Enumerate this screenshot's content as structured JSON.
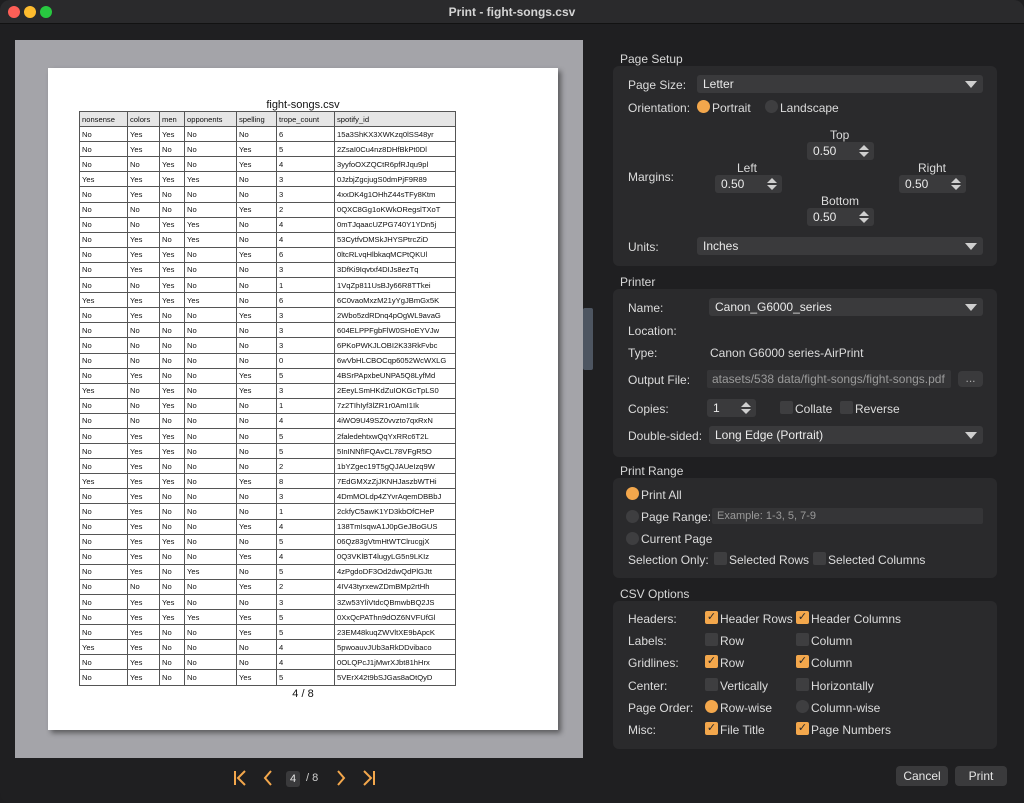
{
  "window": {
    "title": "Print - fight-songs.csv"
  },
  "preview": {
    "sheet_title": "fight-songs.csv",
    "page_indicator": "4 / 8",
    "columns": [
      "nonsense",
      "colors",
      "men",
      "opponents",
      "spelling",
      "trope_count",
      "spotify_id"
    ],
    "rows": [
      [
        "No",
        "Yes",
        "Yes",
        "No",
        "No",
        "6",
        "15a3ShKX3XWKzq0lSS48yr"
      ],
      [
        "No",
        "Yes",
        "No",
        "No",
        "Yes",
        "5",
        "2ZsaI0Cu4nz8DHfBkPt0Dl"
      ],
      [
        "No",
        "No",
        "Yes",
        "No",
        "Yes",
        "4",
        "3yyfoOXZQCtR6pfRJqu9pl"
      ],
      [
        "Yes",
        "Yes",
        "Yes",
        "Yes",
        "No",
        "3",
        "0JzbjZgcjugS0dmPjF9R89"
      ],
      [
        "No",
        "Yes",
        "No",
        "No",
        "No",
        "3",
        "4xxDK4g1OHhZ44sTFy8Ktm"
      ],
      [
        "No",
        "No",
        "No",
        "No",
        "Yes",
        "2",
        "0QXC8Gg1oKWkORegslTXoT"
      ],
      [
        "No",
        "No",
        "Yes",
        "Yes",
        "No",
        "4",
        "0mTJqaacUZPG740Y1YDn5j"
      ],
      [
        "No",
        "Yes",
        "No",
        "Yes",
        "No",
        "4",
        "53CytfvDMSkJHYSPtrcZiD"
      ],
      [
        "No",
        "Yes",
        "Yes",
        "No",
        "Yes",
        "6",
        "0ltcRLvqHlbkaqMCPtQKUl"
      ],
      [
        "No",
        "Yes",
        "Yes",
        "No",
        "No",
        "3",
        "3DfKi9Iqvtxf4DIJs8ezTq"
      ],
      [
        "No",
        "No",
        "Yes",
        "No",
        "No",
        "1",
        "1VqZp811UsBJy66R8TTkei"
      ],
      [
        "Yes",
        "Yes",
        "Yes",
        "Yes",
        "No",
        "6",
        "6C0vaoMxzM21yYgJBmGx5K"
      ],
      [
        "No",
        "Yes",
        "No",
        "No",
        "Yes",
        "3",
        "2Wbo5zdRDnq4pOgWL9avaG"
      ],
      [
        "No",
        "No",
        "No",
        "No",
        "No",
        "3",
        "604ELPPFgbFlW0SHoEYVJw"
      ],
      [
        "No",
        "No",
        "No",
        "No",
        "No",
        "3",
        "6PKoPWKJLOBI2K33RkFvbc"
      ],
      [
        "No",
        "No",
        "No",
        "No",
        "No",
        "0",
        "6wVbHLCBOCqp6052WcWXLG"
      ],
      [
        "No",
        "Yes",
        "No",
        "No",
        "Yes",
        "5",
        "4BSrPApxbeUNPA5Q8LyfMd"
      ],
      [
        "Yes",
        "No",
        "Yes",
        "No",
        "Yes",
        "3",
        "2EeyLSmHKdZuIOKGcTpLS0"
      ],
      [
        "No",
        "No",
        "Yes",
        "No",
        "No",
        "1",
        "7z2TIhIyf3lZR1r0AmI1Ik"
      ],
      [
        "No",
        "No",
        "No",
        "No",
        "No",
        "4",
        "4iWO9U49SZ0vvzto7qxRxN"
      ],
      [
        "No",
        "Yes",
        "Yes",
        "No",
        "No",
        "5",
        "2faledehtxwQqYxRRc6T2L"
      ],
      [
        "No",
        "Yes",
        "Yes",
        "No",
        "No",
        "5",
        "5InINNfIFQAvCL78VFgR5O"
      ],
      [
        "No",
        "Yes",
        "No",
        "No",
        "No",
        "2",
        "1bYZgec19T5gQJAUeIzq9W"
      ],
      [
        "Yes",
        "Yes",
        "Yes",
        "No",
        "Yes",
        "8",
        "7EdGMXzZjJKNHJaszbWTHi"
      ],
      [
        "No",
        "Yes",
        "No",
        "No",
        "No",
        "3",
        "4DmMOLdp4ZYvrAqemDBBbJ"
      ],
      [
        "No",
        "Yes",
        "No",
        "No",
        "No",
        "1",
        "2ckfyC5awK1YD3kbOfCHeP"
      ],
      [
        "No",
        "Yes",
        "No",
        "No",
        "Yes",
        "4",
        "138TmIsqwA1J0pGeJBoGUS"
      ],
      [
        "No",
        "Yes",
        "Yes",
        "No",
        "No",
        "5",
        "06Qz83gVtmHtWTClrucgjX"
      ],
      [
        "No",
        "Yes",
        "No",
        "No",
        "Yes",
        "4",
        "0Q3VKlBT4lugyLG5n9LKIz"
      ],
      [
        "No",
        "Yes",
        "No",
        "Yes",
        "No",
        "5",
        "4zPgdoDF3Od2dwQdPlGJtt"
      ],
      [
        "No",
        "No",
        "No",
        "No",
        "Yes",
        "2",
        "4IV43tyrxewZDmBMp2rtHh"
      ],
      [
        "No",
        "Yes",
        "Yes",
        "No",
        "No",
        "3",
        "3Zw53YliVtdcQBmwbBQ2JS"
      ],
      [
        "No",
        "Yes",
        "Yes",
        "Yes",
        "Yes",
        "5",
        "0XxQcPAThn9dOZ6NVFUfGl"
      ],
      [
        "No",
        "Yes",
        "No",
        "No",
        "Yes",
        "5",
        "23EM48kuqZWVltXE9bApcK"
      ],
      [
        "Yes",
        "Yes",
        "No",
        "No",
        "No",
        "4",
        "5pwoauvJUb3aRkDDvibaco"
      ],
      [
        "No",
        "Yes",
        "No",
        "No",
        "No",
        "4",
        "0OLQPcJ1jMwrXJbt81hHrx"
      ],
      [
        "No",
        "Yes",
        "No",
        "No",
        "Yes",
        "5",
        "5VErX42t9bSJGas8aOtQyD"
      ]
    ]
  },
  "pager": {
    "current": "4",
    "total": "/ 8"
  },
  "page_setup": {
    "section_title": "Page Setup",
    "page_size_label": "Page Size:",
    "page_size_value": "Letter",
    "orientation_label": "Orientation:",
    "portrait": "Portrait",
    "landscape": "Landscape",
    "margins_label": "Margins:",
    "top_label": "Top",
    "top_value": "0.50",
    "left_label": "Left",
    "left_value": "0.50",
    "right_label": "Right",
    "right_value": "0.50",
    "bottom_label": "Bottom",
    "bottom_value": "0.50",
    "units_label": "Units:",
    "units_value": "Inches"
  },
  "printer": {
    "section_title": "Printer",
    "name_label": "Name:",
    "name_value": "Canon_G6000_series",
    "location_label": "Location:",
    "type_label": "Type:",
    "type_value": "Canon G6000 series-AirPrint",
    "output_label": "Output File:",
    "output_value": "atasets/538 data/fight-songs/fight-songs.pdf",
    "browse_label": "...",
    "copies_label": "Copies:",
    "copies_value": "1",
    "collate": "Collate",
    "reverse": "Reverse",
    "double_sided_label": "Double-sided:",
    "double_sided_value": "Long Edge (Portrait)"
  },
  "print_range": {
    "section_title": "Print Range",
    "print_all": "Print All",
    "page_range": "Page Range:",
    "page_range_placeholder": "Example: 1-3, 5, 7-9",
    "current_page": "Current Page",
    "selection_only_label": "Selection Only:",
    "selected_rows": "Selected Rows",
    "selected_columns": "Selected Columns"
  },
  "csv_options": {
    "section_title": "CSV Options",
    "headers_label": "Headers:",
    "header_rows": "Header Rows",
    "header_columns": "Header Columns",
    "labels_label": "Labels:",
    "label_row": "Row",
    "label_column": "Column",
    "gridlines_label": "Gridlines:",
    "grid_row": "Row",
    "grid_column": "Column",
    "center_label": "Center:",
    "vertically": "Vertically",
    "horizontally": "Horizontally",
    "page_order_label": "Page Order:",
    "row_wise": "Row-wise",
    "column_wise": "Column-wise",
    "misc_label": "Misc:",
    "file_title": "File Title",
    "page_numbers": "Page Numbers"
  },
  "actions": {
    "cancel": "Cancel",
    "print": "Print"
  },
  "colors": {
    "accent": "#f3a74c",
    "panel": "#2a2a2c",
    "background": "#1f1f21"
  }
}
